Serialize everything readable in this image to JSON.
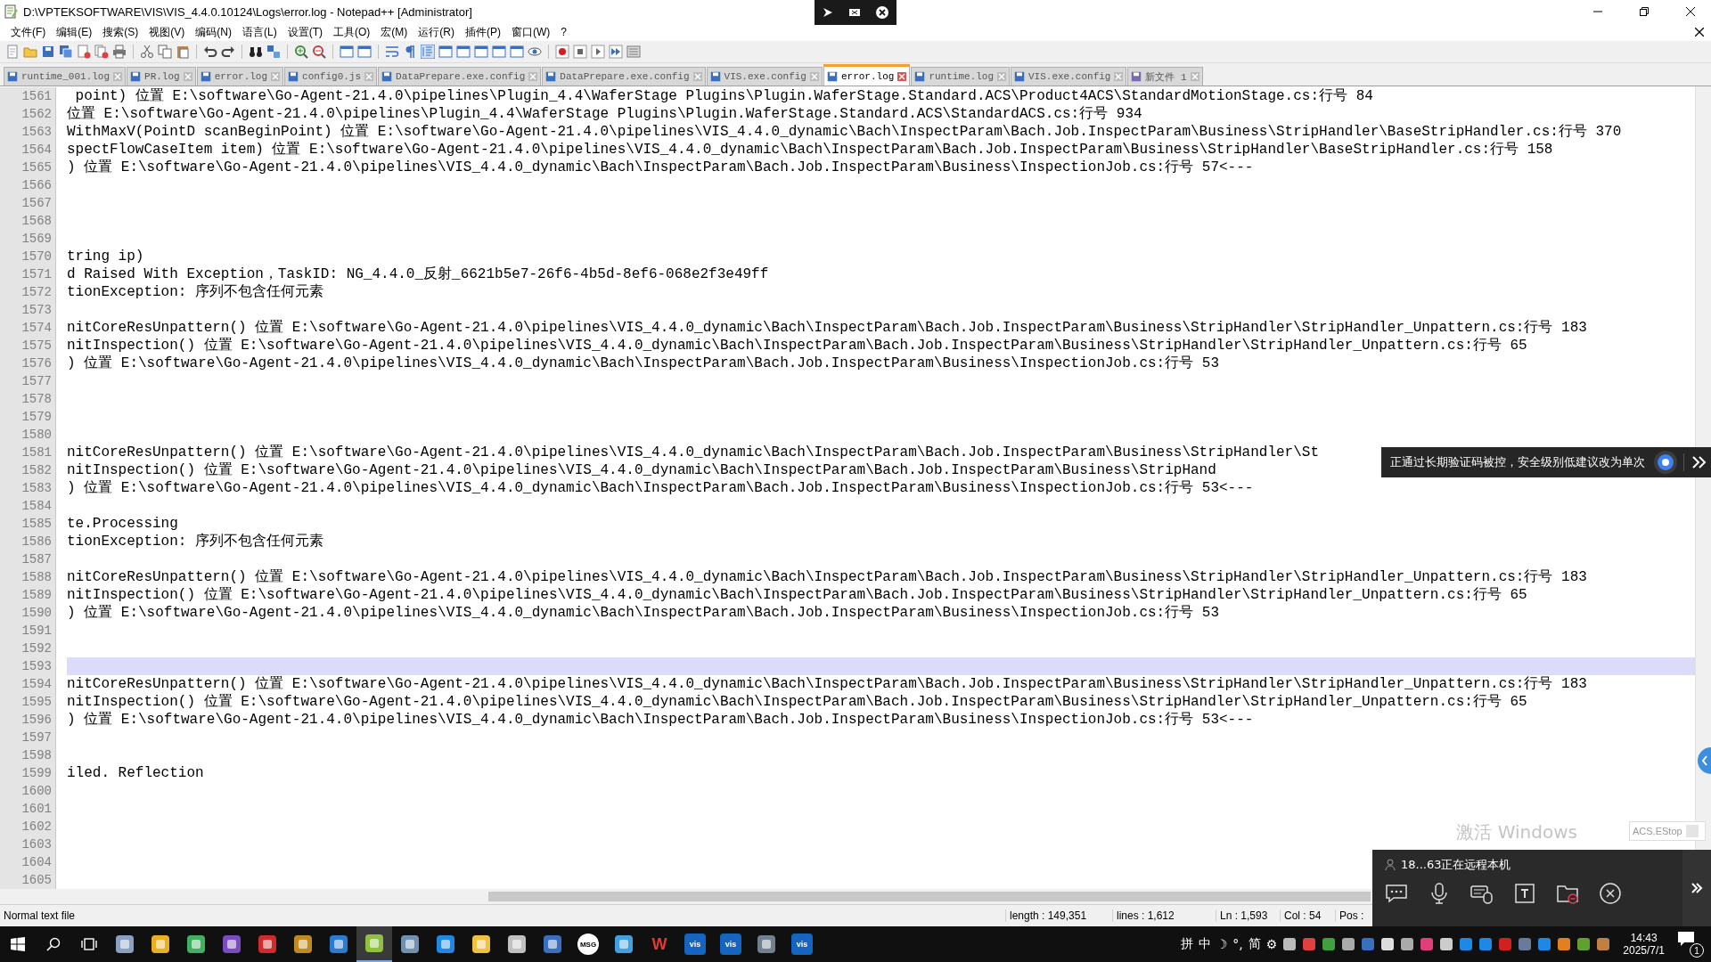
{
  "window": {
    "title": "D:\\VPTEKSOFTWARE\\VIS\\VIS_4.4.0.10124\\Logs\\error.log - Notepad++ [Administrator]"
  },
  "menu": [
    "文件(F)",
    "编辑(E)",
    "搜索(S)",
    "视图(V)",
    "编码(N)",
    "语言(L)",
    "设置(T)",
    "工具(O)",
    "宏(M)",
    "运行(R)",
    "插件(P)",
    "窗口(W)",
    "?"
  ],
  "tabs": [
    {
      "label": "runtime_001.log",
      "selected": false
    },
    {
      "label": "PR.log",
      "selected": false
    },
    {
      "label": "error.log",
      "selected": false
    },
    {
      "label": "config0.js",
      "selected": false
    },
    {
      "label": "DataPrepare.exe.config",
      "selected": false
    },
    {
      "label": "DataPrepare.exe.config",
      "selected": false
    },
    {
      "label": "VIS.exe.config",
      "selected": false
    },
    {
      "label": "error.log",
      "selected": true
    },
    {
      "label": "runtime.log",
      "selected": false
    },
    {
      "label": "VIS.exe.config",
      "selected": false
    },
    {
      "label": "新文件 1",
      "selected": false
    }
  ],
  "lines": [
    {
      "number": "1561",
      "text": " point) 位置 E:\\software\\Go-Agent-21.4.0\\pipelines\\Plugin_4.4\\WaferStage Plugins\\Plugin.WaferStage.Standard.ACS\\Product4ACS\\StandardMotionStage.cs:行号 84",
      "current": false
    },
    {
      "number": "1562",
      "text": "位置 E:\\software\\Go-Agent-21.4.0\\pipelines\\Plugin_4.4\\WaferStage Plugins\\Plugin.WaferStage.Standard.ACS\\StandardACS.cs:行号 934",
      "current": false
    },
    {
      "number": "1563",
      "text": "WithMaxV(PointD scanBeginPoint) 位置 E:\\software\\Go-Agent-21.4.0\\pipelines\\VIS_4.4.0_dynamic\\Bach\\InspectParam\\Bach.Job.InspectParam\\Business\\StripHandler\\BaseStripHandler.cs:行号 370",
      "current": false
    },
    {
      "number": "1564",
      "text": "spectFlowCaseItem item) 位置 E:\\software\\Go-Agent-21.4.0\\pipelines\\VIS_4.4.0_dynamic\\Bach\\InspectParam\\Bach.Job.InspectParam\\Business\\StripHandler\\BaseStripHandler.cs:行号 158",
      "current": false
    },
    {
      "number": "1565",
      "text": ") 位置 E:\\software\\Go-Agent-21.4.0\\pipelines\\VIS_4.4.0_dynamic\\Bach\\InspectParam\\Bach.Job.InspectParam\\Business\\InspectionJob.cs:行号 57<---",
      "current": false
    },
    {
      "number": "1566",
      "current": false
    },
    {
      "number": "1567",
      "current": false
    },
    {
      "number": "1568",
      "current": false
    },
    {
      "number": "1569",
      "current": false
    },
    {
      "number": "1570",
      "text": "tring ip)",
      "current": false
    },
    {
      "number": "1571",
      "text": "d Raised With Exception，TaskID: NG_4.4.0_反射_6621b5e7-26f6-4b5d-8ef6-068e2f3e49ff",
      "current": false
    },
    {
      "number": "1572",
      "text": "tionException: 序列不包含任何元素",
      "current": false
    },
    {
      "number": "1573",
      "current": false
    },
    {
      "number": "1574",
      "text": "nitCoreResUnpattern() 位置 E:\\software\\Go-Agent-21.4.0\\pipelines\\VIS_4.4.0_dynamic\\Bach\\InspectParam\\Bach.Job.InspectParam\\Business\\StripHandler\\StripHandler_Unpattern.cs:行号 183",
      "current": false
    },
    {
      "number": "1575",
      "text": "nitInspection() 位置 E:\\software\\Go-Agent-21.4.0\\pipelines\\VIS_4.4.0_dynamic\\Bach\\InspectParam\\Bach.Job.InspectParam\\Business\\StripHandler\\StripHandler_Unpattern.cs:行号 65",
      "current": false
    },
    {
      "number": "1576",
      "text": ") 位置 E:\\software\\Go-Agent-21.4.0\\pipelines\\VIS_4.4.0_dynamic\\Bach\\InspectParam\\Bach.Job.InspectParam\\Business\\InspectionJob.cs:行号 53",
      "current": false
    },
    {
      "number": "1577",
      "current": false
    },
    {
      "number": "1578",
      "current": false
    },
    {
      "number": "1579",
      "current": false
    },
    {
      "number": "1580",
      "current": false
    },
    {
      "number": "1581",
      "text": "nitCoreResUnpattern() 位置 E:\\software\\Go-Agent-21.4.0\\pipelines\\VIS_4.4.0_dynamic\\Bach\\InspectParam\\Bach.Job.InspectParam\\Business\\StripHandler\\St",
      "current": false
    },
    {
      "number": "1582",
      "text": "nitInspection() 位置 E:\\software\\Go-Agent-21.4.0\\pipelines\\VIS_4.4.0_dynamic\\Bach\\InspectParam\\Bach.Job.InspectParam\\Business\\StripHand",
      "current": false
    },
    {
      "number": "1583",
      "text": ") 位置 E:\\software\\Go-Agent-21.4.0\\pipelines\\VIS_4.4.0_dynamic\\Bach\\InspectParam\\Bach.Job.InspectParam\\Business\\InspectionJob.cs:行号 53<---",
      "current": false
    },
    {
      "number": "1584",
      "current": false
    },
    {
      "number": "1585",
      "text": "te.Processing",
      "current": false
    },
    {
      "number": "1586",
      "text": "tionException: 序列不包含任何元素",
      "current": false
    },
    {
      "number": "1587",
      "current": false
    },
    {
      "number": "1588",
      "text": "nitCoreResUnpattern() 位置 E:\\software\\Go-Agent-21.4.0\\pipelines\\VIS_4.4.0_dynamic\\Bach\\InspectParam\\Bach.Job.InspectParam\\Business\\StripHandler\\StripHandler_Unpattern.cs:行号 183",
      "current": false
    },
    {
      "number": "1589",
      "text": "nitInspection() 位置 E:\\software\\Go-Agent-21.4.0\\pipelines\\VIS_4.4.0_dynamic\\Bach\\InspectParam\\Bach.Job.InspectParam\\Business\\StripHandler\\StripHandler_Unpattern.cs:行号 65",
      "current": false
    },
    {
      "number": "1590",
      "text": ") 位置 E:\\software\\Go-Agent-21.4.0\\pipelines\\VIS_4.4.0_dynamic\\Bach\\InspectParam\\Bach.Job.InspectParam\\Business\\InspectionJob.cs:行号 53",
      "current": false
    },
    {
      "number": "1591",
      "current": false
    },
    {
      "number": "1592",
      "current": false
    },
    {
      "number": "1593",
      "current": true
    },
    {
      "number": "1594",
      "text": "nitCoreResUnpattern() 位置 E:\\software\\Go-Agent-21.4.0\\pipelines\\VIS_4.4.0_dynamic\\Bach\\InspectParam\\Bach.Job.InspectParam\\Business\\StripHandler\\StripHandler_Unpattern.cs:行号 183",
      "current": false
    },
    {
      "number": "1595",
      "text": "nitInspection() 位置 E:\\software\\Go-Agent-21.4.0\\pipelines\\VIS_4.4.0_dynamic\\Bach\\InspectParam\\Bach.Job.InspectParam\\Business\\StripHandler\\StripHandler_Unpattern.cs:行号 65",
      "current": false
    },
    {
      "number": "1596",
      "text": ") 位置 E:\\software\\Go-Agent-21.4.0\\pipelines\\VIS_4.4.0_dynamic\\Bach\\InspectParam\\Bach.Job.InspectParam\\Business\\InspectionJob.cs:行号 53<---",
      "current": false
    },
    {
      "number": "1597",
      "current": false
    },
    {
      "number": "1598",
      "current": false
    },
    {
      "number": "1599",
      "text": "iled. Reflection",
      "current": false
    },
    {
      "number": "1600",
      "current": false
    },
    {
      "number": "1601",
      "current": false
    },
    {
      "number": "1602",
      "current": false
    },
    {
      "number": "1603",
      "current": false
    },
    {
      "number": "1604",
      "current": false
    },
    {
      "number": "1605",
      "current": false
    }
  ],
  "security_popup": {
    "text": "正通过长期验证码被控，安全级别低建议改为单次"
  },
  "status_bar": {
    "file_type": "Normal text file",
    "length": "length : 149,351",
    "lines": "lines : 1,612",
    "ln": "Ln : 1,593",
    "col": "Col : 54",
    "pos": "Pos :"
  },
  "watermark": {
    "text": "激活 Windows"
  },
  "estop_window": {
    "title": "ACS.EStop"
  },
  "remote_panel": {
    "user": "18...63正在远程本机"
  },
  "taskbar": {
    "apps": [
      {
        "kind": "icon",
        "selected": false
      },
      {
        "kind": "icon",
        "selected": false
      },
      {
        "kind": "icon",
        "selected": false
      },
      {
        "kind": "icon",
        "selected": false
      },
      {
        "kind": "icon",
        "selected": false
      },
      {
        "kind": "icon",
        "selected": false
      },
      {
        "kind": "icon",
        "selected": false
      },
      {
        "kind": "icon",
        "selected": true
      },
      {
        "kind": "icon",
        "selected": false
      },
      {
        "kind": "icon",
        "selected": false
      },
      {
        "kind": "icon",
        "selected": false
      },
      {
        "kind": "icon",
        "selected": false
      },
      {
        "kind": "icon",
        "selected": false
      },
      {
        "kind": "badge",
        "label": "MSG",
        "selected": false
      },
      {
        "kind": "icon",
        "selected": false
      },
      {
        "kind": "badge",
        "label": "W",
        "selected": false
      },
      {
        "kind": "badge",
        "label": "vis",
        "selected": false
      },
      {
        "kind": "badge",
        "label": "vis",
        "selected": false
      },
      {
        "kind": "icon",
        "selected": false
      },
      {
        "kind": "badge",
        "label": "vis",
        "selected": false
      }
    ],
    "ime": [
      "拼",
      "中",
      "☽",
      "°,",
      "简",
      "⚙"
    ],
    "time": "14:43",
    "date": "2025/7/1",
    "notifications": "1"
  }
}
